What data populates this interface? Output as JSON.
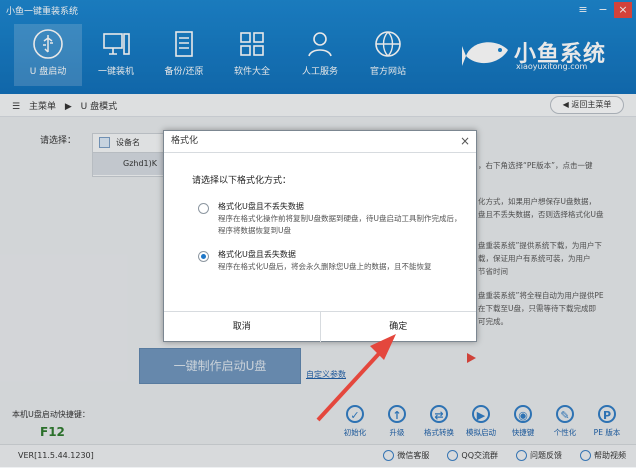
{
  "app": {
    "title": "小鱼一键重装系统",
    "win_menu": "≡",
    "win_min": "−",
    "win_close": "×"
  },
  "nav": {
    "items": [
      {
        "label": "U 盘启动",
        "icon": "usb-icon"
      },
      {
        "label": "一键装机",
        "icon": "monitor-icon"
      },
      {
        "label": "备份/还原",
        "icon": "backup-icon"
      },
      {
        "label": "软件大全",
        "icon": "apps-grid-icon"
      },
      {
        "label": "人工服务",
        "icon": "user-service-icon"
      },
      {
        "label": "官方网站",
        "icon": "globe-icon"
      }
    ]
  },
  "brand": {
    "name": "小鱼系统",
    "site": "xiaoyuxitong.com"
  },
  "breadcrumb": {
    "home": "主菜单",
    "sep": "▶",
    "current": "U 盘模式",
    "back": "返回主菜单"
  },
  "main": {
    "choose_label": "请选择：",
    "table_header": "设备名",
    "table_row": "Gzhd1)K",
    "side_lines": [
      "，右下角选择“PE版本”，点击一键",
      "",
      "化方式，如果用户想保存U盘数据，",
      "盘且不丢失数据，否则选择格式化U盘",
      "",
      "",
      "盘重装系统”提供系统下载，为用户下",
      "载，保证用户有系统可装，为用户",
      "节省时间",
      "",
      "盘重装系统”将全程自动为用户提供PE",
      "在下载至U盘，只需等待下载完成即",
      "可完成。"
    ],
    "make_button": "一键制作启动U盘",
    "custom_link": "自定义参数",
    "hotkey_label": "本机U盘启动快捷键：",
    "hotkey_value": "F12"
  },
  "tools": [
    {
      "label": "初始化",
      "icon": "check-circle-icon",
      "glyph": "✓"
    },
    {
      "label": "升级",
      "icon": "upgrade-icon",
      "glyph": "↑"
    },
    {
      "label": "格式转换",
      "icon": "convert-icon",
      "glyph": "⇄"
    },
    {
      "label": "模拟启动",
      "icon": "simulate-boot-icon",
      "glyph": "▶"
    },
    {
      "label": "快捷键",
      "icon": "mouse-icon",
      "glyph": "◉"
    },
    {
      "label": "个性化",
      "icon": "brush-icon",
      "glyph": "✎"
    },
    {
      "label": "PE 版本",
      "icon": "pe-icon",
      "glyph": "P"
    }
  ],
  "status": {
    "version": "VER[11.5.44.1230]",
    "links": [
      {
        "label": "微信客服",
        "icon": "wechat-icon"
      },
      {
        "label": "QQ交流群",
        "icon": "qq-icon"
      },
      {
        "label": "问题反馈",
        "icon": "feedback-icon"
      },
      {
        "label": "帮助视频",
        "icon": "help-video-icon"
      }
    ]
  },
  "dialog": {
    "title": "格式化",
    "close": "×",
    "prompt": "请选择以下格式化方式：",
    "options": [
      {
        "title": "格式化U盘且不丢失数据",
        "desc": "程序在格式化操作前将复制U盘数据到硬盘，待U盘启动工具制作完成后，程序将数据恢复到U盘",
        "selected": false
      },
      {
        "title": "格式化U盘且丢失数据",
        "desc": "程序在格式化U盘后，将会永久删除您U盘上的数据，且不能恢复",
        "selected": true
      }
    ],
    "cancel": "取消",
    "ok": "确定"
  },
  "colors": {
    "header_blue": "#1580cb",
    "accent_red": "#e4473d",
    "hotkey_green": "#2d7a2d"
  }
}
